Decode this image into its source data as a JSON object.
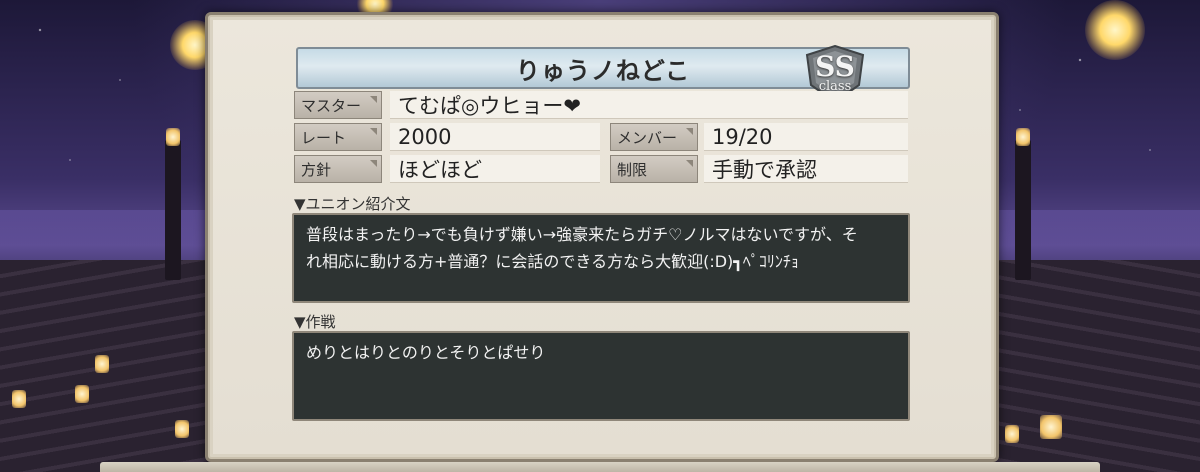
{
  "union": {
    "name": "りゅうノねどこ",
    "class_badge": {
      "rank": "SS",
      "sub": "class"
    }
  },
  "info": {
    "master_label": "マスター",
    "master_value": "てむぱ◎ウヒョー❤",
    "rate_label": "レート",
    "rate_value": "2000",
    "members_label": "メンバー",
    "members_value": "19/20",
    "policy_label": "方針",
    "policy_value": "ほどほど",
    "restriction_label": "制限",
    "restriction_value": "手動で承認"
  },
  "intro": {
    "heading": "▼ユニオン紹介文",
    "line1": "普段はまったり→でも負けず嫌い→強豪来たらガチ♡ノルマはないですが、そ",
    "line2": "れ相応に動ける方+普通？に会話のできる方なら大歓迎(:D)┓ﾍﾟｺﾘﾝﾁｮ"
  },
  "strategy": {
    "heading": "▼作戦",
    "text": "めりとはりとのりとそりとぱせり"
  },
  "colors": {
    "panel_bg": "#ece7dc",
    "title_bar": "#c6dbe6",
    "textbox_bg": "#2d3332"
  }
}
